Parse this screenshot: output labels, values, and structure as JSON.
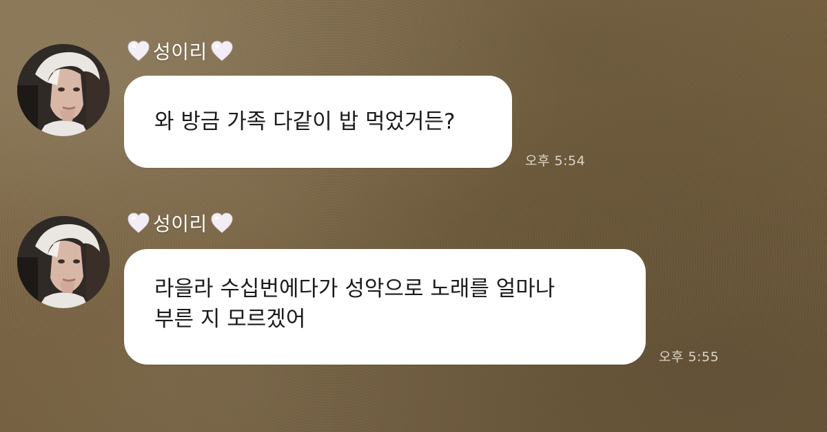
{
  "messages": [
    {
      "sender": "성이리",
      "text": "와 방금 가족 다같이 밥 먹었거든?",
      "time": "오후 5:54",
      "avatar_icon": "profile-photo",
      "name_icon": "white-heart-icon"
    },
    {
      "sender": "성이리",
      "text": "라을라 수십번에다가 성악으로 노래를 얼마나\n부른 지 모르겠어",
      "time": "오후 5:55",
      "avatar_icon": "profile-photo",
      "name_icon": "white-heart-icon"
    }
  ],
  "colors": {
    "bubble": "#ffffff",
    "background": "#7a6547",
    "heart": "#f3eef6",
    "timestamp": "#f2ece2"
  }
}
